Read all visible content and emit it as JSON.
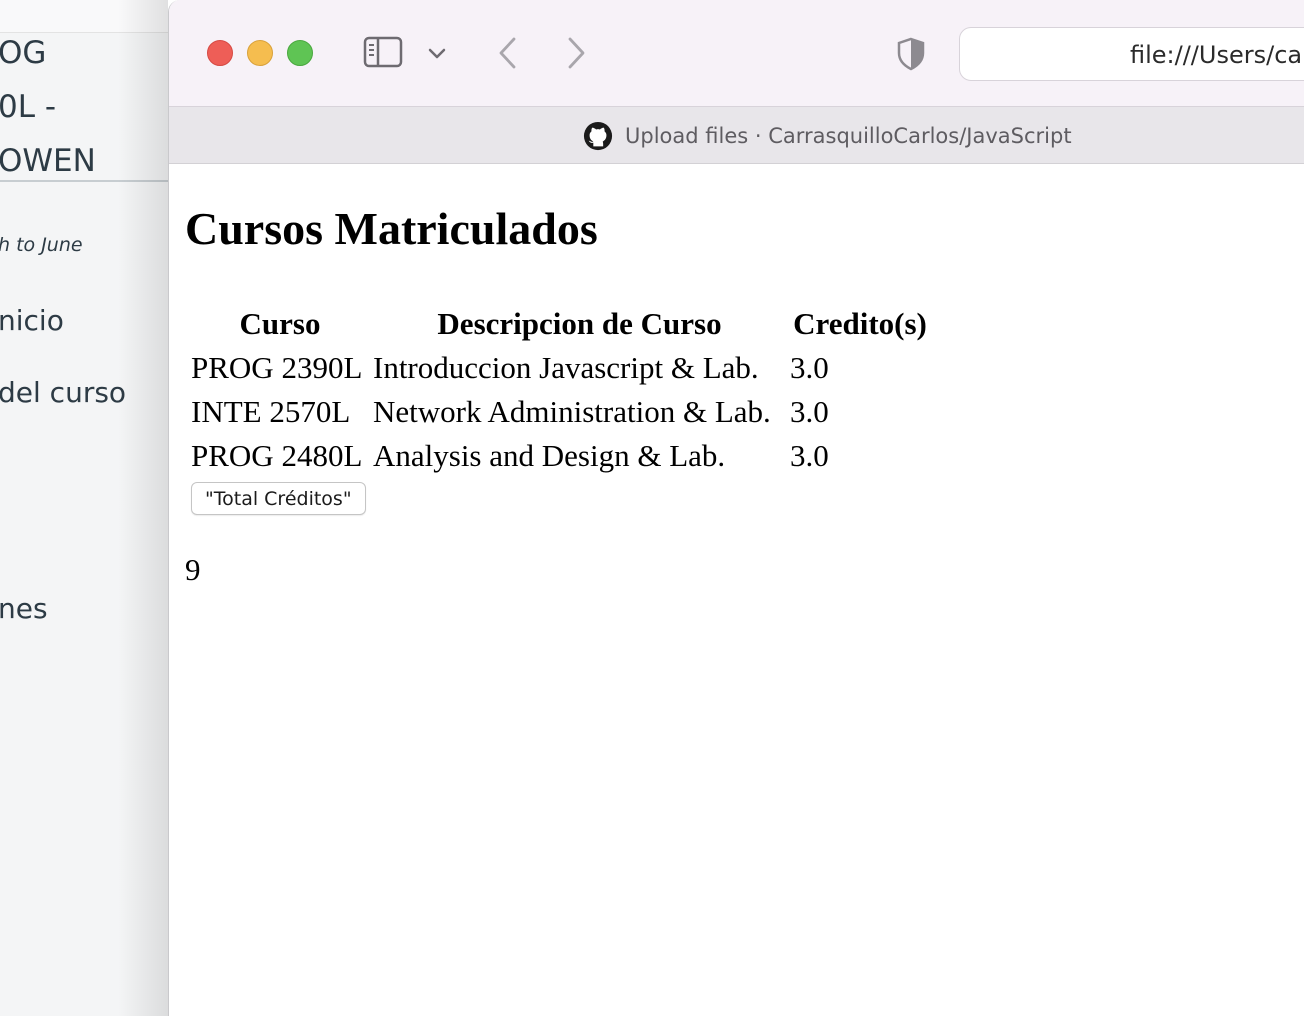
{
  "background_page": {
    "course_title_lines": [
      "OG",
      "0L -",
      "OWEN"
    ],
    "term": "h to June",
    "nav_items": [
      "nicio",
      "del curso",
      "nes"
    ]
  },
  "browser": {
    "address": "file:///Users/ca",
    "tab_title": "Upload files · CarrasquilloCarlos/JavaScript",
    "icons": {
      "sidebar": "sidebar-icon",
      "chevron": "chevron-down-icon",
      "back": "chevron-left-icon",
      "forward": "chevron-right-icon",
      "privacy": "shield-icon",
      "tab": "github-icon"
    }
  },
  "page": {
    "title": "Cursos Matriculados",
    "table": {
      "headers": [
        "Curso",
        "Descripcion de Curso",
        "Credito(s)"
      ],
      "rows": [
        [
          "PROG 2390L",
          "Introduccion Javascript & Lab.",
          "3.0"
        ],
        [
          "INTE 2570L",
          "Network Administration & Lab.",
          "3.0"
        ],
        [
          "PROG 2480L",
          "Analysis and Design & Lab.",
          "3.0"
        ]
      ]
    },
    "button_label": "\"Total Créditos\"",
    "total": "9"
  },
  "colors": {
    "close": "#ee5e57",
    "minimize": "#f5bd4f",
    "maximize": "#5fc454",
    "lms_text": "#2d3b45"
  }
}
